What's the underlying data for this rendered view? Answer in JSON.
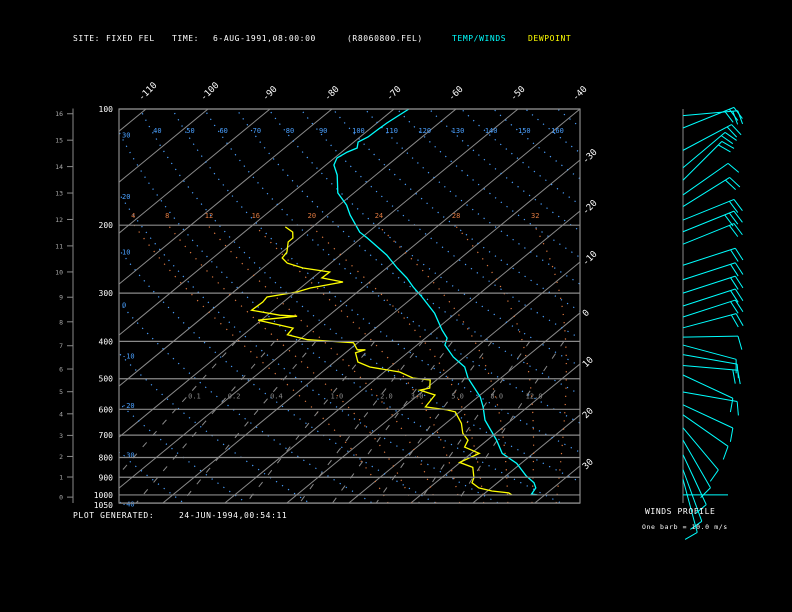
{
  "header": {
    "site_label": "SITE:",
    "site": "FIXED FEL",
    "time_label": "TIME:",
    "time": "6-AUG-1991,08:00:00",
    "file": "(R8060800.FEL)",
    "legend_temp": "TEMP/WINDS",
    "legend_dew": "DEWPOINT"
  },
  "footer": {
    "generated_label": "PLOT GENERATED:",
    "generated": "24-JUN-1994,00:54:11"
  },
  "winds_panel": {
    "title": "WINDS PROFILE",
    "note": "One barb = 10.0 m/s"
  },
  "colors": {
    "background": "#000000",
    "temperature": "#00ffff",
    "dewpoint": "#ffff00",
    "isotherm": "#8a8a8a",
    "dry_adiabat": "#4aa0ff",
    "moist_adiabat": "#e07a40",
    "mixing_ratio": "#8a8a8a",
    "text": "#ffffff"
  },
  "chart_data": {
    "type": "line",
    "diagram": "skew-T log-p",
    "pressure_range": [
      100,
      1050
    ],
    "pressure_ticks": [
      100,
      200,
      300,
      400,
      500,
      600,
      700,
      800,
      900,
      1000,
      1050
    ],
    "temperature_ticks_top": [
      -110,
      -100,
      -90,
      -80,
      -70,
      -60,
      -50,
      -40
    ],
    "temperature_ticks_right": [
      -30,
      -20,
      -10,
      0,
      10,
      20,
      30
    ],
    "height_km_ticks": [
      0,
      1,
      2,
      3,
      4,
      5,
      6,
      7,
      8,
      9,
      10,
      11,
      12,
      13,
      14,
      15,
      16
    ],
    "isotherm_step": 10,
    "dry_adiabat_labels_top": [
      40,
      50,
      60,
      70,
      80,
      90,
      100,
      110,
      120,
      130,
      140,
      150,
      160
    ],
    "dry_adiabat_labels_left": [
      30,
      20,
      10,
      0,
      -10,
      -20,
      -30,
      -40
    ],
    "moist_adiabat_labels": [
      4,
      8,
      12,
      16,
      20,
      24,
      28,
      32
    ],
    "mixing_ratio_labels": [
      0.1,
      0.2,
      0.4,
      1,
      2,
      3,
      5,
      8,
      12
    ],
    "grid": true,
    "series": [
      {
        "name": "TEMP/WINDS",
        "points": [
          [
            100,
            -67.6
          ],
          [
            108.7,
            -68.4
          ],
          [
            113.4,
            -68.6
          ],
          [
            118.2,
            -68.7
          ],
          [
            121.8,
            -69.3
          ],
          [
            126.2,
            -68.3
          ],
          [
            129.3,
            -69.1
          ],
          [
            133.9,
            -69.6
          ],
          [
            139.7,
            -68.7
          ],
          [
            148.3,
            -66.2
          ],
          [
            165,
            -62.6
          ],
          [
            177.4,
            -58.8
          ],
          [
            188.2,
            -56.3
          ],
          [
            208.4,
            -51.4
          ],
          [
            215.9,
            -49.0
          ],
          [
            239.1,
            -42.5
          ],
          [
            258.2,
            -38.3
          ],
          [
            274,
            -34.8
          ],
          [
            289.2,
            -32.0
          ],
          [
            307.1,
            -28.6
          ],
          [
            338.2,
            -23.4
          ],
          [
            373.9,
            -18.9
          ],
          [
            392.4,
            -16.5
          ],
          [
            408.8,
            -15.5
          ],
          [
            439.2,
            -11.8
          ],
          [
            466.2,
            -8.0
          ],
          [
            497.9,
            -5.3
          ],
          [
            557.4,
            0.4
          ],
          [
            591.5,
            2.8
          ],
          [
            640.1,
            5.7
          ],
          [
            721.5,
            11.5
          ],
          [
            780.5,
            15.0
          ],
          [
            828.8,
            19.3
          ],
          [
            891.6,
            23.2
          ],
          [
            930.5,
            25.9
          ],
          [
            959.3,
            27.2
          ],
          [
            994.4,
            27.7
          ],
          [
            1000,
            28.8
          ]
        ]
      },
      {
        "name": "DEWPOINT",
        "points": [
          [
            202.1,
            -64.4
          ],
          [
            208.4,
            -62.2
          ],
          [
            215.9,
            -61.0
          ],
          [
            221,
            -61.0
          ],
          [
            234.9,
            -59.2
          ],
          [
            243.3,
            -58.8
          ],
          [
            250.8,
            -57.0
          ],
          [
            258.2,
            -53.5
          ],
          [
            264.5,
            -48.4
          ],
          [
            274,
            -48.5
          ],
          [
            280.7,
            -44.3
          ],
          [
            290.9,
            -48.4
          ],
          [
            297.9,
            -49.8
          ],
          [
            307.1,
            -53.6
          ],
          [
            316.4,
            -53.3
          ],
          [
            332.2,
            -53.5
          ],
          [
            342.2,
            -48.0
          ],
          [
            344.2,
            -45.0
          ],
          [
            352.5,
            -50.5
          ],
          [
            363.1,
            -46.0
          ],
          [
            369.6,
            -43.3
          ],
          [
            384.8,
            -42.9
          ],
          [
            396.1,
            -38.7
          ],
          [
            403.3,
            -30.7
          ],
          [
            420.6,
            -28.7
          ],
          [
            420.6,
            -27.4
          ],
          [
            428.3,
            -28.4
          ],
          [
            452.6,
            -26.2
          ],
          [
            466.2,
            -23.3
          ],
          [
            480.3,
            -17.5
          ],
          [
            497.9,
            -14.2
          ],
          [
            503.9,
            -11.0
          ],
          [
            528.8,
            -9.5
          ],
          [
            535.2,
            -10.7
          ],
          [
            550.8,
            -7.3
          ],
          [
            591.5,
            -6.5
          ],
          [
            602.2,
            -2.4
          ],
          [
            609.4,
            -0.7
          ],
          [
            652.1,
            2.5
          ],
          [
            692.4,
            4.7
          ],
          [
            721.5,
            6.9
          ],
          [
            751.9,
            7.7
          ],
          [
            780.5,
            11.3
          ],
          [
            823.9,
            9.9
          ],
          [
            848.5,
            13.0
          ],
          [
            902.2,
            15.2
          ],
          [
            930.5,
            15.9
          ],
          [
            959.3,
            18.0
          ],
          [
            976.8,
            20.7
          ],
          [
            988.3,
            23.8
          ],
          [
            1000,
            24.7
          ]
        ]
      }
    ],
    "winds": [
      {
        "p": 104,
        "direction_deg": 85,
        "speed_ms": 20
      },
      {
        "p": 112,
        "direction_deg": 68,
        "speed_ms": 30
      },
      {
        "p": 128,
        "direction_deg": 62,
        "speed_ms": 20
      },
      {
        "p": 142,
        "direction_deg": 50,
        "speed_ms": 20
      },
      {
        "p": 153,
        "direction_deg": 45,
        "speed_ms": 20
      },
      {
        "p": 167,
        "direction_deg": 55,
        "speed_ms": 10
      },
      {
        "p": 179,
        "direction_deg": 58,
        "speed_ms": 20
      },
      {
        "p": 194,
        "direction_deg": 68,
        "speed_ms": 20
      },
      {
        "p": 208,
        "direction_deg": 68,
        "speed_ms": 30
      },
      {
        "p": 224,
        "direction_deg": 68,
        "speed_ms": 20
      },
      {
        "p": 254,
        "direction_deg": 72,
        "speed_ms": 20
      },
      {
        "p": 277,
        "direction_deg": 72,
        "speed_ms": 20
      },
      {
        "p": 300,
        "direction_deg": 72,
        "speed_ms": 20
      },
      {
        "p": 324,
        "direction_deg": 72,
        "speed_ms": 20
      },
      {
        "p": 346,
        "direction_deg": 72,
        "speed_ms": 20
      },
      {
        "p": 369,
        "direction_deg": 75,
        "speed_ms": 20
      },
      {
        "p": 390,
        "direction_deg": 89,
        "speed_ms": 10
      },
      {
        "p": 409,
        "direction_deg": 105,
        "speed_ms": 10
      },
      {
        "p": 433,
        "direction_deg": 100,
        "speed_ms": 10
      },
      {
        "p": 462,
        "direction_deg": 95,
        "speed_ms": 20
      },
      {
        "p": 489,
        "direction_deg": 115,
        "speed_ms": 10
      },
      {
        "p": 541,
        "direction_deg": 100,
        "speed_ms": 10
      },
      {
        "p": 584,
        "direction_deg": 115,
        "speed_ms": 10
      },
      {
        "p": 620,
        "direction_deg": 125,
        "speed_ms": 10
      },
      {
        "p": 670,
        "direction_deg": 140,
        "speed_ms": 10
      },
      {
        "p": 721,
        "direction_deg": 150,
        "speed_ms": 10
      },
      {
        "p": 787,
        "direction_deg": 155,
        "speed_ms": 10
      },
      {
        "p": 860,
        "direction_deg": 160,
        "speed_ms": 10
      },
      {
        "p": 911,
        "direction_deg": 165,
        "speed_ms": 10
      },
      {
        "p": 1000,
        "direction_deg": 90,
        "speed_ms": 0
      }
    ]
  }
}
